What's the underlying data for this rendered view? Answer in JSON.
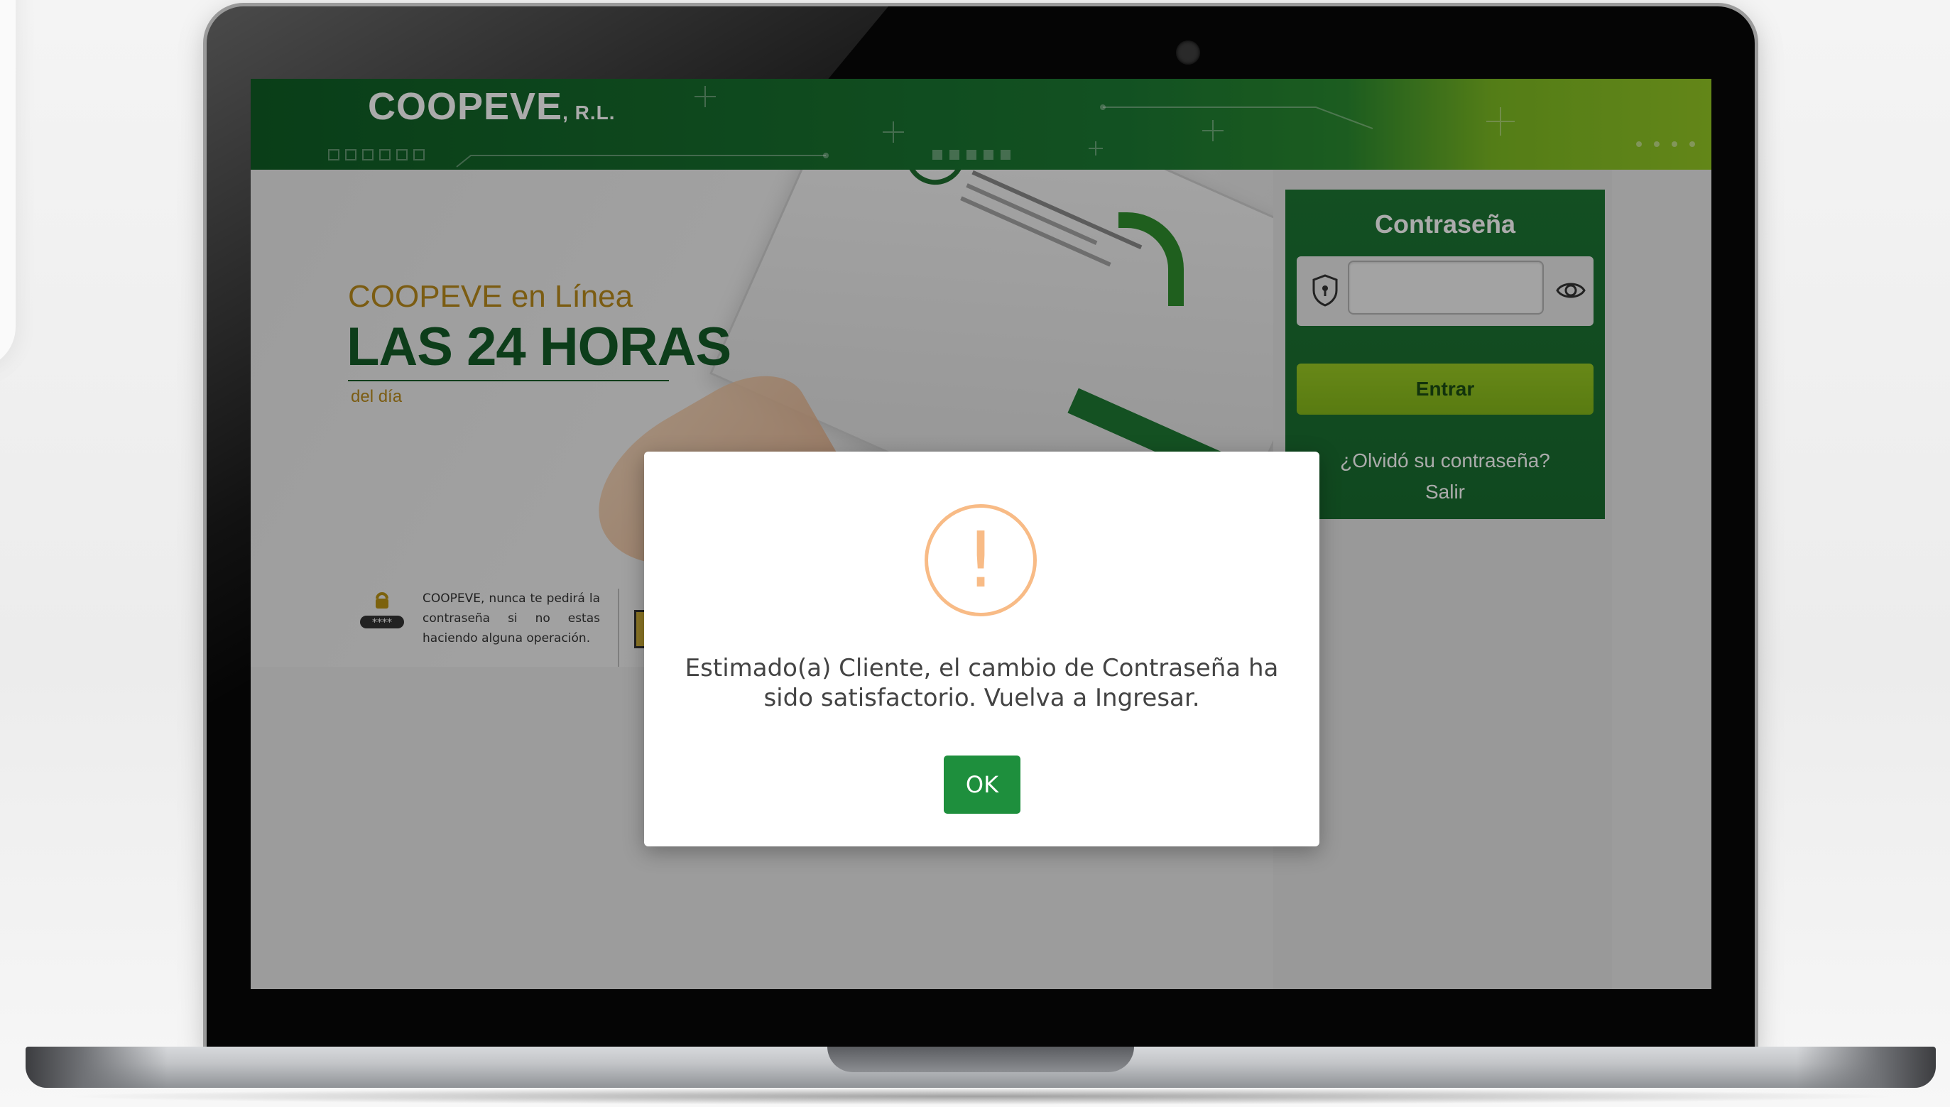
{
  "header": {
    "logo_main": "COOPEVE",
    "logo_suffix": ", R.L."
  },
  "hero": {
    "subtitle": "COOPEVE en Línea",
    "title": "LAS 24 HORAS",
    "small": "del día"
  },
  "tip": {
    "text": "COOPEVE, nunca te pedirá la contraseña si no estas haciendo alguna operación.",
    "lock_label": "****"
  },
  "login_panel": {
    "title": "Contraseña",
    "password_value": "",
    "submit_label": "Entrar",
    "forgot_link": "¿Olvidó su contraseña?",
    "exit_link": "Salir"
  },
  "modal": {
    "icon_mark": "!",
    "message": "Estimado(a) Cliente, el cambio de Contraseña ha sido satisfactorio. Vuelva a Ingresar.",
    "ok_label": "OK"
  },
  "colors": {
    "brand_dark_green": "#145c28",
    "brand_lime": "#94c824",
    "warning_orange": "#f8bb86",
    "ok_green": "#1e8f3d"
  },
  "icons": {
    "shield": "shield-icon",
    "eye": "eye-icon",
    "lock": "lock-icon",
    "warning": "warning-icon"
  }
}
